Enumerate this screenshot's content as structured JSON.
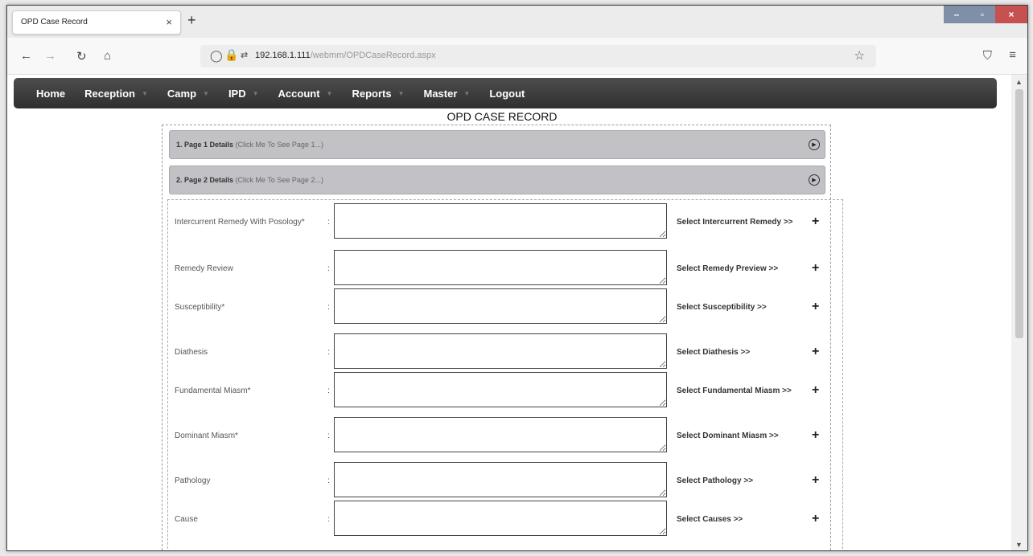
{
  "browser": {
    "tab_title": "OPD Case Record",
    "tab_close": "×",
    "new_tab": "+",
    "url_host": "192.168.1.111",
    "url_path": "/webmm/OPDCaseRecord.aspx",
    "window_controls": {
      "minimize": "–",
      "maximize": "▫",
      "close": "×"
    }
  },
  "app_menu": {
    "items": [
      {
        "label": "Home",
        "has_dropdown": false
      },
      {
        "label": "Reception",
        "has_dropdown": true
      },
      {
        "label": "Camp",
        "has_dropdown": true
      },
      {
        "label": "IPD",
        "has_dropdown": true
      },
      {
        "label": "Account",
        "has_dropdown": true
      },
      {
        "label": "Reports",
        "has_dropdown": true
      },
      {
        "label": "Master",
        "has_dropdown": true
      },
      {
        "label": "Logout",
        "has_dropdown": false
      }
    ]
  },
  "page": {
    "title": "OPD CASE RECORD"
  },
  "sections": [
    {
      "label": "1. Page 1 Details",
      "hint": "(Click Me To See Page 1...)"
    },
    {
      "label": "2. Page 2 Details",
      "hint": "(Click Me To See Page 2...)"
    }
  ],
  "fields": [
    {
      "label": "Intercurrent Remedy With Posology*",
      "value": "",
      "select_label": "Select Intercurrent Remedy >>"
    },
    {
      "label": "Remedy Review",
      "value": "",
      "select_label": "Select Remedy Preview >>"
    },
    {
      "label": "Susceptibility*",
      "value": "",
      "select_label": "Select Susceptibility >>"
    },
    {
      "label": "Diathesis",
      "value": "",
      "select_label": "Select Diathesis >>"
    },
    {
      "label": "Fundamental Miasm*",
      "value": "",
      "select_label": "Select Fundamental Miasm >>"
    },
    {
      "label": "Dominant Miasm*",
      "value": "",
      "select_label": "Select Dominant Miasm >>"
    },
    {
      "label": "Pathology",
      "value": "",
      "select_label": "Select Pathology >>"
    },
    {
      "label": "Cause",
      "value": "",
      "select_label": "Select Causes >>"
    }
  ]
}
